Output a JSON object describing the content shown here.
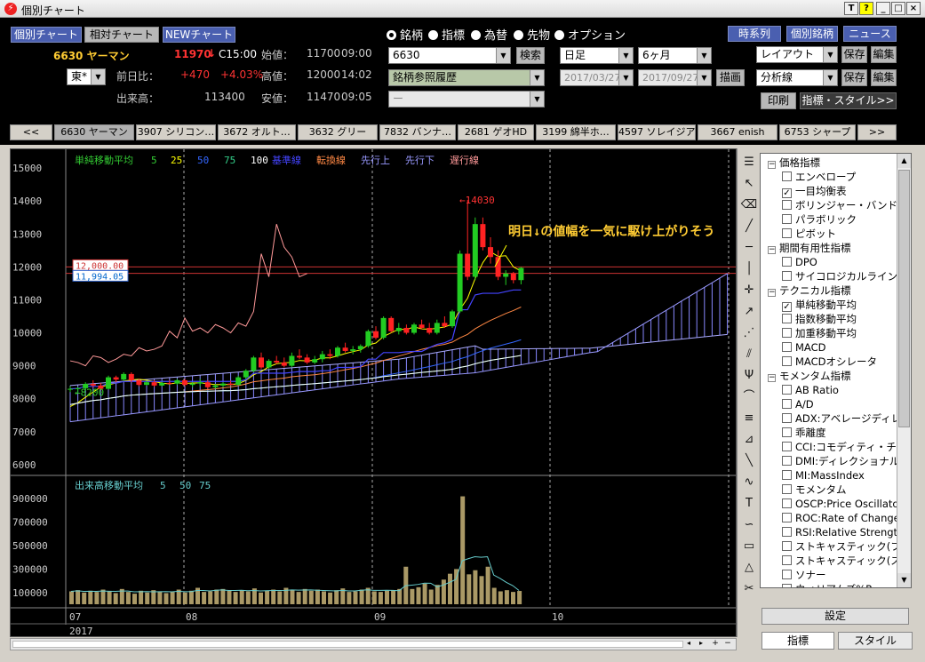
{
  "window": {
    "title": "個別チャート",
    "buttons": [
      "T",
      "?",
      "_",
      "□",
      "×"
    ]
  },
  "toolbar": {
    "nav_buttons": [
      "個別チャート",
      "相対チャート",
      "NEWチャート"
    ],
    "radios": [
      {
        "label": "銘柄",
        "selected": true
      },
      {
        "label": "指標",
        "selected": false
      },
      {
        "label": "為替",
        "selected": false
      },
      {
        "label": "先物",
        "selected": false
      },
      {
        "label": "オプション",
        "selected": false
      }
    ],
    "right_buttons": [
      "時系列",
      "個別銘柄",
      "ニュース"
    ]
  },
  "quote": {
    "code_name": "6630 ヤーマン",
    "price": "11970",
    "arrow": "↓",
    "c_time": "C15:00",
    "market": "東*",
    "prev_label": "前日比：",
    "change": "+470",
    "change_pct": "+4.03%",
    "volume_label": "出来高：",
    "volume": "113400",
    "open_label": "始値：",
    "open": "11700",
    "open_time": "09:00",
    "high_label": "高値：",
    "high": "12000",
    "high_time": "14:02",
    "low_label": "安値：",
    "low": "11470",
    "low_time": "09:05"
  },
  "search": {
    "code": "6630",
    "search_btn": "検索",
    "history": "銘柄参照履歴",
    "blank": "ー"
  },
  "period": {
    "interval": "日足",
    "range": "6ヶ月",
    "from": "2017/03/27",
    "to": "2017/09/27",
    "draw_btn": "描画"
  },
  "layout": {
    "layout_sel": "レイアウト",
    "save": "保存",
    "edit": "編集",
    "analysis_sel": "分析線",
    "save2": "保存",
    "edit2": "編集",
    "print": "印刷",
    "style_btn": "指標・スタイル>>"
  },
  "tabs": [
    "<<",
    "6630 ヤーマン",
    "3907 シリコン…",
    "3672 オルト…",
    "3632 グリー",
    "7832 バンナ…",
    "2681 ゲオHD",
    "3199 綿半ホ…",
    "4597 ソレイジア",
    "3667 enish",
    "6753 シャープ",
    ">>"
  ],
  "legend": {
    "title": "単純移動平均",
    "periods": [
      "5",
      "25",
      "50",
      "75",
      "100"
    ],
    "period_colors": [
      "#3c3",
      "#ff0",
      "#36f",
      "#3c8",
      "#fff"
    ],
    "ichimoku": [
      "基準線",
      "転換線",
      "先行上",
      "先行下",
      "遅行線"
    ],
    "ichimoku_colors": [
      "#44f",
      "#f84",
      "#99f",
      "#99f",
      "#f99"
    ]
  },
  "annotation": {
    "high_mark": "←14030",
    "low_mark": "←8200",
    "comment": "明日↓の値幅を一気に駆け上がりそう",
    "price_tag1": "12,000.00",
    "price_tag2": "11,994.05"
  },
  "volume_legend": {
    "title": "出来高移動平均",
    "periods": [
      "5",
      "50",
      "75"
    ]
  },
  "chart_data": {
    "type": "candlestick",
    "y_axis": {
      "ticks": [
        6000,
        7000,
        8000,
        9000,
        10000,
        11000,
        12000,
        13000,
        14000,
        15000
      ],
      "range": [
        5700,
        15300
      ]
    },
    "volume_axis": {
      "ticks": [
        "100000",
        "300000",
        "500000",
        "700000",
        "900000"
      ],
      "range": [
        0,
        1000000
      ]
    },
    "x_labels": [
      "07",
      "08",
      "09",
      "10"
    ],
    "year_label": "2017",
    "candles": [
      [
        8280,
        8380,
        8200,
        8300
      ],
      [
        8300,
        8350,
        8180,
        8320
      ],
      [
        8320,
        8500,
        8240,
        8450
      ],
      [
        8450,
        8560,
        8350,
        8400
      ],
      [
        8400,
        8480,
        8260,
        8300
      ],
      [
        8300,
        8700,
        8280,
        8650
      ],
      [
        8650,
        8700,
        8500,
        8580
      ],
      [
        8580,
        8800,
        8540,
        8750
      ],
      [
        8750,
        8800,
        8500,
        8560
      ],
      [
        8560,
        8600,
        8380,
        8420
      ],
      [
        8420,
        8550,
        8400,
        8500
      ],
      [
        8500,
        8560,
        8360,
        8400
      ],
      [
        8400,
        8520,
        8380,
        8480
      ],
      [
        8480,
        8560,
        8420,
        8460
      ],
      [
        8460,
        8600,
        8420,
        8560
      ],
      [
        8560,
        8600,
        8380,
        8420
      ],
      [
        8420,
        8500,
        8350,
        8460
      ],
      [
        8460,
        8600,
        8380,
        8500
      ],
      [
        8500,
        8560,
        8300,
        8350
      ],
      [
        8350,
        8450,
        8300,
        8400
      ],
      [
        8400,
        8500,
        8350,
        8460
      ],
      [
        8460,
        8550,
        8400,
        8420
      ],
      [
        8420,
        8700,
        8400,
        8650
      ],
      [
        8650,
        8900,
        8600,
        8850
      ],
      [
        8850,
        9300,
        8800,
        9250
      ],
      [
        9250,
        9400,
        8900,
        8950
      ],
      [
        8950,
        9200,
        8900,
        9150
      ],
      [
        9150,
        9300,
        9050,
        9100
      ],
      [
        9100,
        9250,
        8950,
        9000
      ],
      [
        9000,
        9400,
        8950,
        9300
      ],
      [
        9300,
        9500,
        9200,
        9250
      ],
      [
        9250,
        9350,
        9050,
        9100
      ],
      [
        9100,
        9300,
        9050,
        9200
      ],
      [
        9200,
        9450,
        9100,
        9350
      ],
      [
        9350,
        9500,
        9200,
        9300
      ],
      [
        9300,
        9600,
        9250,
        9550
      ],
      [
        9550,
        9700,
        9400,
        9450
      ],
      [
        9450,
        9600,
        9350,
        9500
      ],
      [
        9500,
        9650,
        9400,
        9600
      ],
      [
        9600,
        10100,
        9550,
        10050
      ],
      [
        10050,
        10200,
        9800,
        9850
      ],
      [
        9850,
        10500,
        9800,
        10450
      ],
      [
        10450,
        10500,
        10000,
        10050
      ],
      [
        10050,
        10300,
        9950,
        10150
      ],
      [
        10150,
        10250,
        9950,
        10000
      ],
      [
        10000,
        10300,
        9950,
        10250
      ],
      [
        10250,
        10400,
        10100,
        10150
      ],
      [
        10150,
        10300,
        9950,
        10000
      ],
      [
        10000,
        10400,
        9950,
        10300
      ],
      [
        10300,
        10500,
        10150,
        10200
      ],
      [
        10200,
        10700,
        10150,
        10650
      ],
      [
        10650,
        12500,
        10600,
        12400
      ],
      [
        12400,
        14030,
        11600,
        11700
      ],
      [
        11700,
        13500,
        11600,
        13300
      ],
      [
        13300,
        13500,
        12500,
        12600
      ],
      [
        12600,
        12900,
        12100,
        12300
      ],
      [
        12300,
        12500,
        11600,
        11700
      ],
      [
        11700,
        11900,
        11450,
        11800
      ],
      [
        11800,
        11850,
        11500,
        11600
      ],
      [
        11600,
        12000,
        11470,
        11970
      ]
    ],
    "volume": [
      110000,
      120000,
      100000,
      115000,
      105000,
      125000,
      110000,
      95000,
      130000,
      105000,
      90000,
      115000,
      100000,
      120000,
      110000,
      95000,
      105000,
      125000,
      100000,
      115000,
      140000,
      105000,
      110000,
      125000,
      130000,
      115000,
      105000,
      120000,
      110000,
      135000,
      100000,
      115000,
      125000,
      110000,
      140000,
      120000,
      105000,
      130000,
      115000,
      125000,
      110000,
      100000,
      120000,
      135000,
      105000,
      110000,
      125000,
      140000,
      110000,
      105000,
      115000,
      120000,
      130000,
      320000,
      130000,
      145000,
      175000,
      125000,
      165000,
      210000,
      260000,
      300000,
      920000,
      255000,
      290000,
      240000,
      320000,
      140000,
      110000,
      120000,
      105000,
      113400
    ]
  },
  "side_panel": {
    "items": [
      {
        "t": "価格指標",
        "lv": 0,
        "c": false
      },
      {
        "t": "エンベロープ",
        "lv": 1,
        "c": false
      },
      {
        "t": "一目均衡表",
        "lv": 1,
        "c": true
      },
      {
        "t": "ボリンジャー・バンド",
        "lv": 1,
        "c": false
      },
      {
        "t": "パラボリック",
        "lv": 1,
        "c": false
      },
      {
        "t": "ピボット",
        "lv": 1,
        "c": false
      },
      {
        "t": "期間有用性指標",
        "lv": 0,
        "c": false
      },
      {
        "t": "DPO",
        "lv": 1,
        "c": false
      },
      {
        "t": "サイコロジカルライン",
        "lv": 1,
        "c": false
      },
      {
        "t": "テクニカル指標",
        "lv": 0,
        "c": false
      },
      {
        "t": "単純移動平均",
        "lv": 1,
        "c": true
      },
      {
        "t": "指数移動平均",
        "lv": 1,
        "c": false
      },
      {
        "t": "加重移動平均",
        "lv": 1,
        "c": false
      },
      {
        "t": "MACD",
        "lv": 1,
        "c": false
      },
      {
        "t": "MACDオシレータ",
        "lv": 1,
        "c": false
      },
      {
        "t": "モメンタム指標",
        "lv": 0,
        "c": false
      },
      {
        "t": "AB Ratio",
        "lv": 1,
        "c": false
      },
      {
        "t": "A/D",
        "lv": 1,
        "c": false
      },
      {
        "t": "ADX:アベレージディレ",
        "lv": 1,
        "c": false
      },
      {
        "t": "乖離度",
        "lv": 1,
        "c": false
      },
      {
        "t": "CCI:コモディティ・チャ",
        "lv": 1,
        "c": false
      },
      {
        "t": "DMI:ディレクショナル",
        "lv": 1,
        "c": false
      },
      {
        "t": "MI:MassIndex",
        "lv": 1,
        "c": false
      },
      {
        "t": "モメンタム",
        "lv": 1,
        "c": false
      },
      {
        "t": "OSCP:Price Oscillato",
        "lv": 1,
        "c": false
      },
      {
        "t": "ROC:Rate of Change",
        "lv": 1,
        "c": false
      },
      {
        "t": "RSI:Relative Strength",
        "lv": 1,
        "c": false
      },
      {
        "t": "ストキャスティック(ファ",
        "lv": 1,
        "c": false
      },
      {
        "t": "ストキャスティック(スロ",
        "lv": 1,
        "c": false
      },
      {
        "t": "ソナー",
        "lv": 1,
        "c": false
      },
      {
        "t": "ウィリアムズ%R",
        "lv": 1,
        "c": false
      }
    ],
    "settings_btn": "設定",
    "bottom_tabs": [
      "指標",
      "スタイル"
    ]
  },
  "colors": {
    "up": "#2c2",
    "down": "#f22",
    "volume": "#aa9966",
    "background": "#000"
  }
}
